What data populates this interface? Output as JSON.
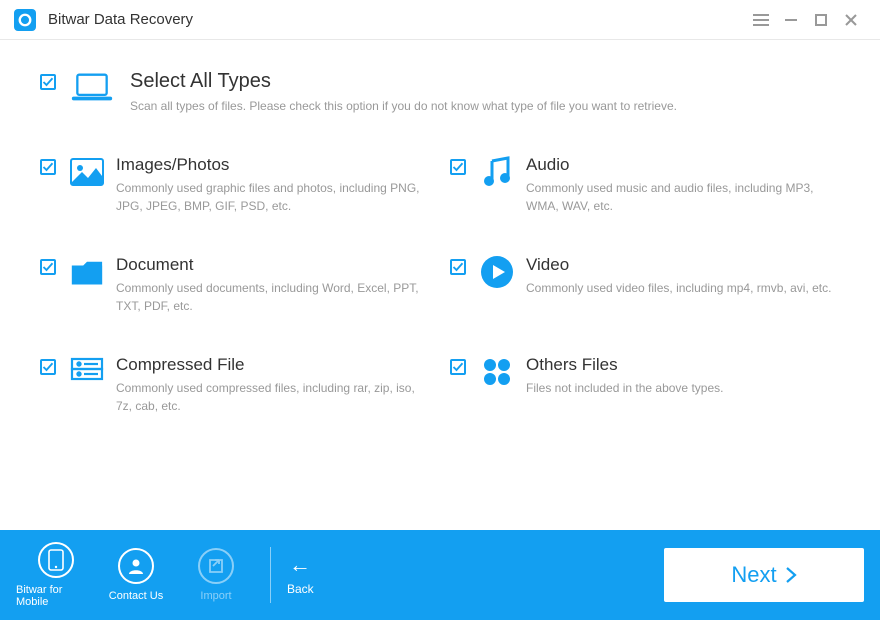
{
  "app": {
    "title": "Bitwar Data Recovery"
  },
  "colors": {
    "accent": "#139ff1"
  },
  "selectAll": {
    "title": "Select All Types",
    "desc": "Scan all types of files. Please check this option if you do not know what type of file you want to retrieve.",
    "checked": true
  },
  "types": [
    {
      "id": "images",
      "title": "Images/Photos",
      "desc": "Commonly used graphic files and photos, including PNG, JPG, JPEG, BMP, GIF, PSD, etc.",
      "checked": true,
      "icon": "image"
    },
    {
      "id": "audio",
      "title": "Audio",
      "desc": "Commonly used music and audio files, including MP3, WMA, WAV, etc.",
      "checked": true,
      "icon": "audio"
    },
    {
      "id": "document",
      "title": "Document",
      "desc": "Commonly used documents, including Word, Excel, PPT, TXT, PDF, etc.",
      "checked": true,
      "icon": "document"
    },
    {
      "id": "video",
      "title": "Video",
      "desc": "Commonly used video files, including mp4, rmvb, avi, etc.",
      "checked": true,
      "icon": "video"
    },
    {
      "id": "compressed",
      "title": "Compressed File",
      "desc": "Commonly used compressed files, including rar, zip, iso, 7z, cab, etc.",
      "checked": true,
      "icon": "compressed"
    },
    {
      "id": "others",
      "title": "Others Files",
      "desc": "Files not included in the above types.",
      "checked": true,
      "icon": "others"
    }
  ],
  "footer": {
    "mobile": "Bitwar for Mobile",
    "contact": "Contact Us",
    "import": "Import",
    "back": "Back",
    "next": "Next"
  }
}
